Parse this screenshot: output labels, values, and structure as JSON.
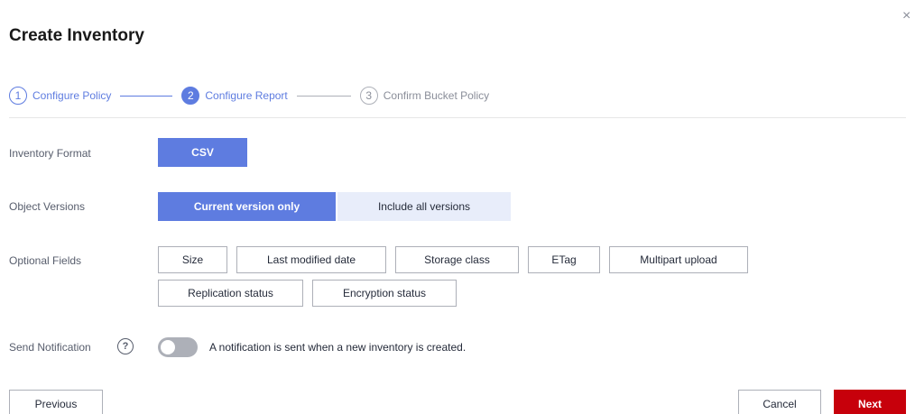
{
  "dialog": {
    "title": "Create Inventory",
    "close_glyph": "×"
  },
  "steps": [
    {
      "number": "1",
      "label": "Configure Policy",
      "state": "done"
    },
    {
      "number": "2",
      "label": "Configure Report",
      "state": "active"
    },
    {
      "number": "3",
      "label": "Confirm Bucket Policy",
      "state": "todo"
    }
  ],
  "form": {
    "inventory_format": {
      "label": "Inventory Format",
      "options": [
        {
          "label": "CSV",
          "selected": true
        }
      ]
    },
    "object_versions": {
      "label": "Object Versions",
      "options": [
        {
          "label": "Current version only",
          "selected": true
        },
        {
          "label": "Include all versions",
          "selected": false
        }
      ]
    },
    "optional_fields": {
      "label": "Optional Fields",
      "options": [
        "Size",
        "Last modified date",
        "Storage class",
        "ETag",
        "Multipart upload",
        "Replication status",
        "Encryption status"
      ]
    },
    "send_notification": {
      "label": "Send Notification",
      "help_glyph": "?",
      "enabled": false,
      "description": "A notification is sent when a new inventory is created."
    }
  },
  "footer": {
    "previous_label": "Previous",
    "cancel_label": "Cancel",
    "next_label": "Next"
  },
  "colors": {
    "accent": "#5e7ce0",
    "primary_button": "#c7000b",
    "segment_off": "#e8edfa"
  }
}
